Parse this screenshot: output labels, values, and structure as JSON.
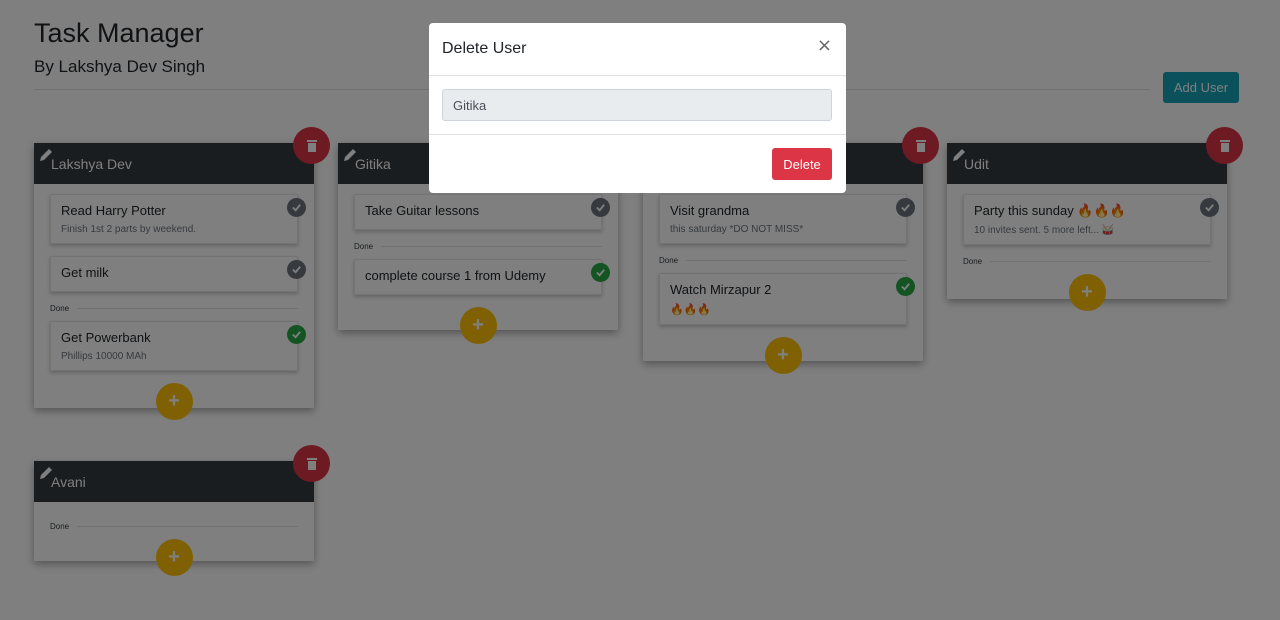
{
  "app": {
    "title": "Task Manager",
    "subtitle": "By Lakshya Dev Singh",
    "add_user_label": "Add User"
  },
  "colors": {
    "header": "#343a40",
    "danger": "#dc3545",
    "warning": "#ffc107",
    "info": "#17a2b8",
    "success": "#28a745",
    "secondary": "#6c757d"
  },
  "columns": [
    {
      "name": "Lakshya Dev",
      "tasks": [
        {
          "title": "Read Harry Potter",
          "desc": "Finish 1st 2 parts by weekend."
        },
        {
          "title": "Get milk"
        }
      ],
      "done_label": "Done",
      "done_tasks": [
        {
          "title": "Get Powerbank",
          "desc": "Phillips 10000 MAh"
        }
      ]
    },
    {
      "name": "Gitika",
      "tasks": [
        {
          "title": "Take Guitar lessons"
        }
      ],
      "done_label": "Done",
      "done_tasks": [
        {
          "title": "complete course 1 from Udemy"
        }
      ]
    },
    {
      "name": "",
      "tasks": [
        {
          "title": "Visit grandma",
          "desc": "this saturday *DO NOT MISS*"
        }
      ],
      "done_label": "Done",
      "done_tasks": [
        {
          "title": "Watch Mirzapur 2",
          "desc": "🔥🔥🔥"
        }
      ]
    },
    {
      "name": "Udit",
      "tasks": [
        {
          "title": "Party this sunday 🔥🔥🔥",
          "desc": "10 invites sent. 5 more left... 🥁"
        }
      ],
      "done_label": "Done",
      "done_tasks": []
    },
    {
      "name": "Avani",
      "tasks": [],
      "done_label": "Done",
      "done_tasks": []
    }
  ],
  "modal": {
    "title": "Delete User",
    "close_glyph": "×",
    "input_value": "Gitika",
    "delete_label": "Delete"
  },
  "icons": {
    "edit": "pencil-icon",
    "delete": "trash-icon",
    "check": "check-circle-icon",
    "add": "plus-icon"
  }
}
